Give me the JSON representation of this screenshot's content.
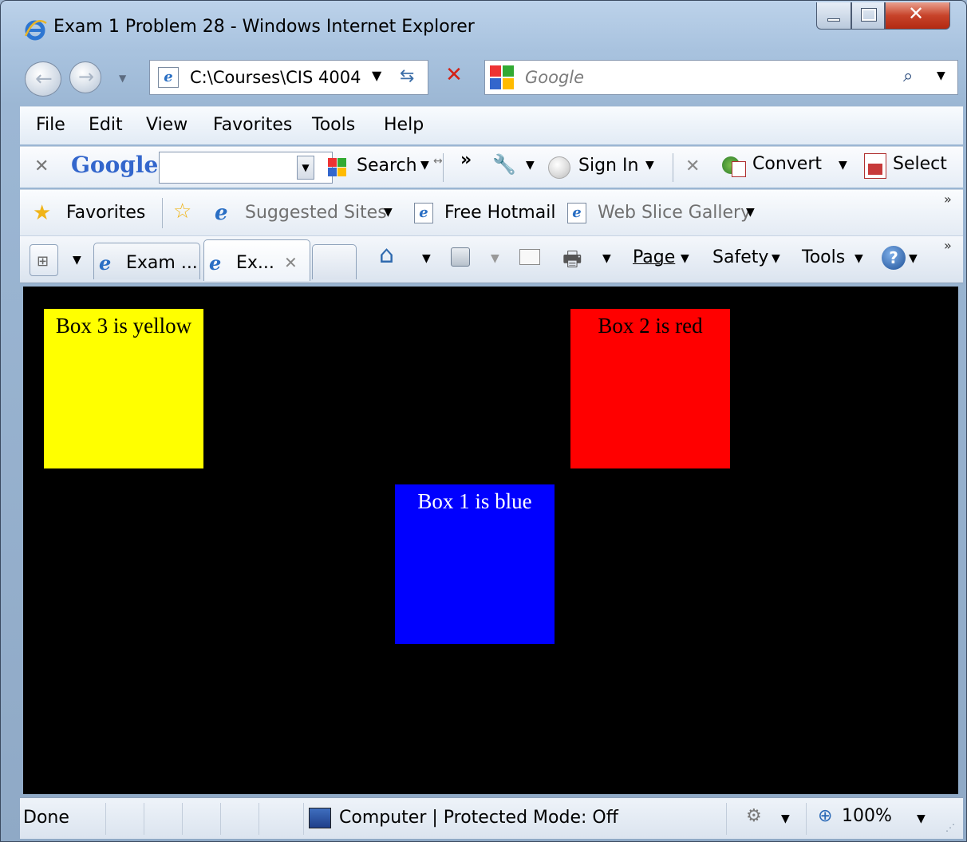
{
  "window": {
    "title": "Exam 1 Problem 28 - Windows Internet Explorer"
  },
  "nav": {
    "address": "C:\\Courses\\CIS 4004",
    "search_placeholder": "Google"
  },
  "menu": [
    "File",
    "Edit",
    "View",
    "Favorites",
    "Tools",
    "Help"
  ],
  "google_toolbar": {
    "logo": "Google",
    "search_value": "",
    "search_label": "Search",
    "sign_in_label": "Sign In",
    "convert_label": "Convert",
    "select_label": "Select"
  },
  "favorites_bar": {
    "favorites_label": "Favorites",
    "suggested_sites": "Suggested Sites",
    "free_hotmail": "Free Hotmail",
    "web_slice_gallery": "Web Slice Gallery"
  },
  "tabs": [
    {
      "label": "Exam ...",
      "active": false
    },
    {
      "label": "Ex...",
      "active": true
    }
  ],
  "command_bar": {
    "page_label": "Page",
    "safety_label": "Safety",
    "tools_label": "Tools"
  },
  "page": {
    "background": "#000000",
    "boxes": [
      {
        "id": "box3",
        "text": "Box 3 is yellow",
        "color": "#ffff00"
      },
      {
        "id": "box2",
        "text": "Box 2 is red",
        "color": "#ff0000"
      },
      {
        "id": "box1",
        "text": "Box 1 is blue",
        "color": "#0000ff"
      }
    ]
  },
  "status": {
    "text": "Done",
    "zone": "Computer | Protected Mode: Off",
    "zoom": "100%"
  }
}
